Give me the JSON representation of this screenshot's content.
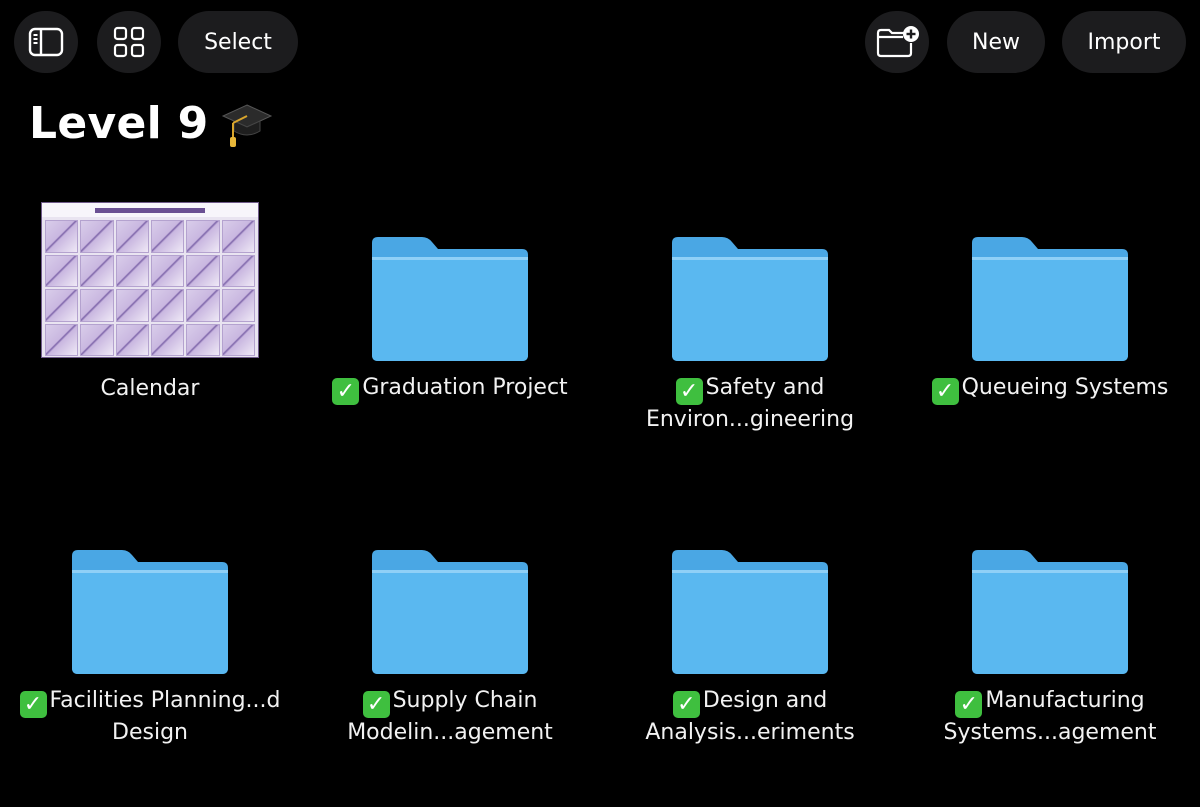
{
  "toolbar": {
    "sidebar_icon": "sidebar-icon",
    "grid_icon": "grid-view-icon",
    "select_label": "Select",
    "new_folder_icon": "new-folder-icon",
    "new_label": "New",
    "import_label": "Import"
  },
  "page": {
    "title": "Level 9",
    "title_emoji": "graduation-cap-icon"
  },
  "items": [
    {
      "type": "document",
      "label": "Calendar",
      "checked": false
    },
    {
      "type": "folder",
      "label": "Graduation Project",
      "checked": true
    },
    {
      "type": "folder",
      "label": "Safety and Environ...gineering",
      "checked": true
    },
    {
      "type": "folder",
      "label": "Queueing Systems",
      "checked": true
    },
    {
      "type": "folder",
      "label": "Facilities Planning...d Design",
      "checked": true
    },
    {
      "type": "folder",
      "label": "Supply Chain Modelin...agement",
      "checked": true
    },
    {
      "type": "folder",
      "label": "Design and Analysis...eriments",
      "checked": true
    },
    {
      "type": "folder",
      "label": "Manufacturing Systems...agement",
      "checked": true
    }
  ],
  "colors": {
    "background": "#000000",
    "button": "#1c1c1e",
    "folder": "#5ab4ee",
    "check": "#3fbf3f"
  }
}
